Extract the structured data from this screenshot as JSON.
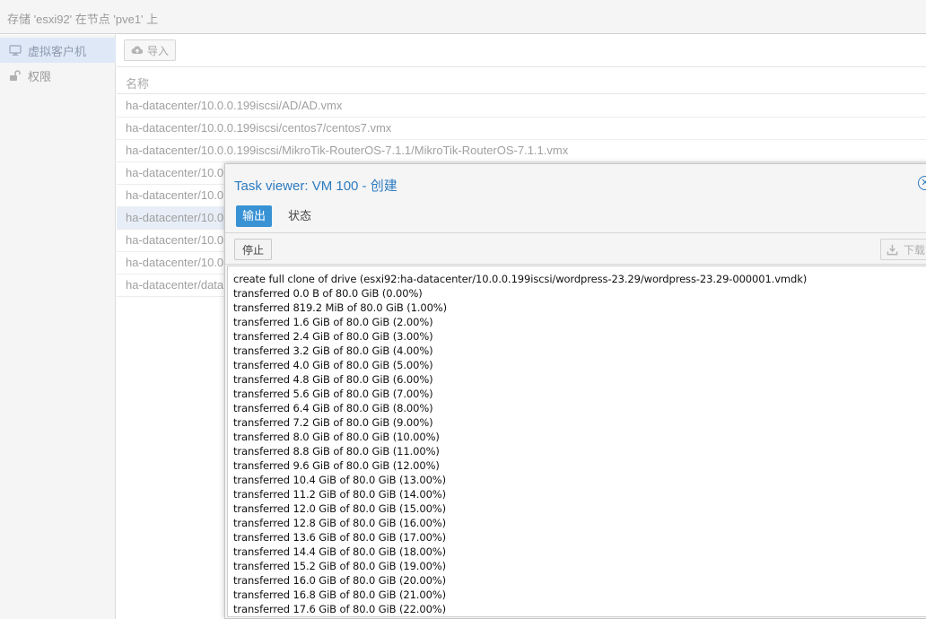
{
  "header": {
    "title": "存储 'esxi92' 在节点 'pve1' 上"
  },
  "sidebar": {
    "items": [
      {
        "label": "虚拟客户机",
        "icon": "monitor-icon",
        "active": true
      },
      {
        "label": "权限",
        "icon": "unlock-icon",
        "active": false
      }
    ]
  },
  "toolbar": {
    "import_label": "导入",
    "import_icon": "cloud-upload-icon"
  },
  "grid": {
    "column_name": "名称",
    "rows": [
      "ha-datacenter/10.0.0.199iscsi/AD/AD.vmx",
      "ha-datacenter/10.0.0.199iscsi/centos7/centos7.vmx",
      "ha-datacenter/10.0.0.199iscsi/MikroTik-RouterOS-7.1.1/MikroTik-RouterOS-7.1.1.vmx",
      "ha-datacenter/10.0",
      "ha-datacenter/10.0",
      "ha-datacenter/10.0",
      "ha-datacenter/10.0",
      "ha-datacenter/10.0",
      "ha-datacenter/data"
    ],
    "selected_row": 5
  },
  "task_viewer": {
    "title": "Task viewer: VM 100 - 创建",
    "tabs": [
      "输出",
      "状态"
    ],
    "active_tab": 0,
    "stop_label": "停止",
    "download_label": "下载",
    "download_icon": "download-icon",
    "close_icon": "close-icon",
    "log_lines": [
      "create full clone of drive (esxi92:ha-datacenter/10.0.0.199iscsi/wordpress-23.29/wordpress-23.29-000001.vmdk)",
      "transferred 0.0 B of 80.0 GiB (0.00%)",
      "transferred 819.2 MiB of 80.0 GiB (1.00%)",
      "transferred 1.6 GiB of 80.0 GiB (2.00%)",
      "transferred 2.4 GiB of 80.0 GiB (3.00%)",
      "transferred 3.2 GiB of 80.0 GiB (4.00%)",
      "transferred 4.0 GiB of 80.0 GiB (5.00%)",
      "transferred 4.8 GiB of 80.0 GiB (6.00%)",
      "transferred 5.6 GiB of 80.0 GiB (7.00%)",
      "transferred 6.4 GiB of 80.0 GiB (8.00%)",
      "transferred 7.2 GiB of 80.0 GiB (9.00%)",
      "transferred 8.0 GiB of 80.0 GiB (10.00%)",
      "transferred 8.8 GiB of 80.0 GiB (11.00%)",
      "transferred 9.6 GiB of 80.0 GiB (12.00%)",
      "transferred 10.4 GiB of 80.0 GiB (13.00%)",
      "transferred 11.2 GiB of 80.0 GiB (14.00%)",
      "transferred 12.0 GiB of 80.0 GiB (15.00%)",
      "transferred 12.8 GiB of 80.0 GiB (16.00%)",
      "transferred 13.6 GiB of 80.0 GiB (17.00%)",
      "transferred 14.4 GiB of 80.0 GiB (18.00%)",
      "transferred 15.2 GiB of 80.0 GiB (19.00%)",
      "transferred 16.0 GiB of 80.0 GiB (20.00%)",
      "transferred 16.8 GiB of 80.0 GiB (21.00%)",
      "transferred 17.6 GiB of 80.0 GiB (22.00%)"
    ]
  },
  "colors": {
    "accent": "#2d7bc1",
    "active_tab_bg": "#3892d4",
    "nav_active_bg": "#dfe8f6"
  }
}
